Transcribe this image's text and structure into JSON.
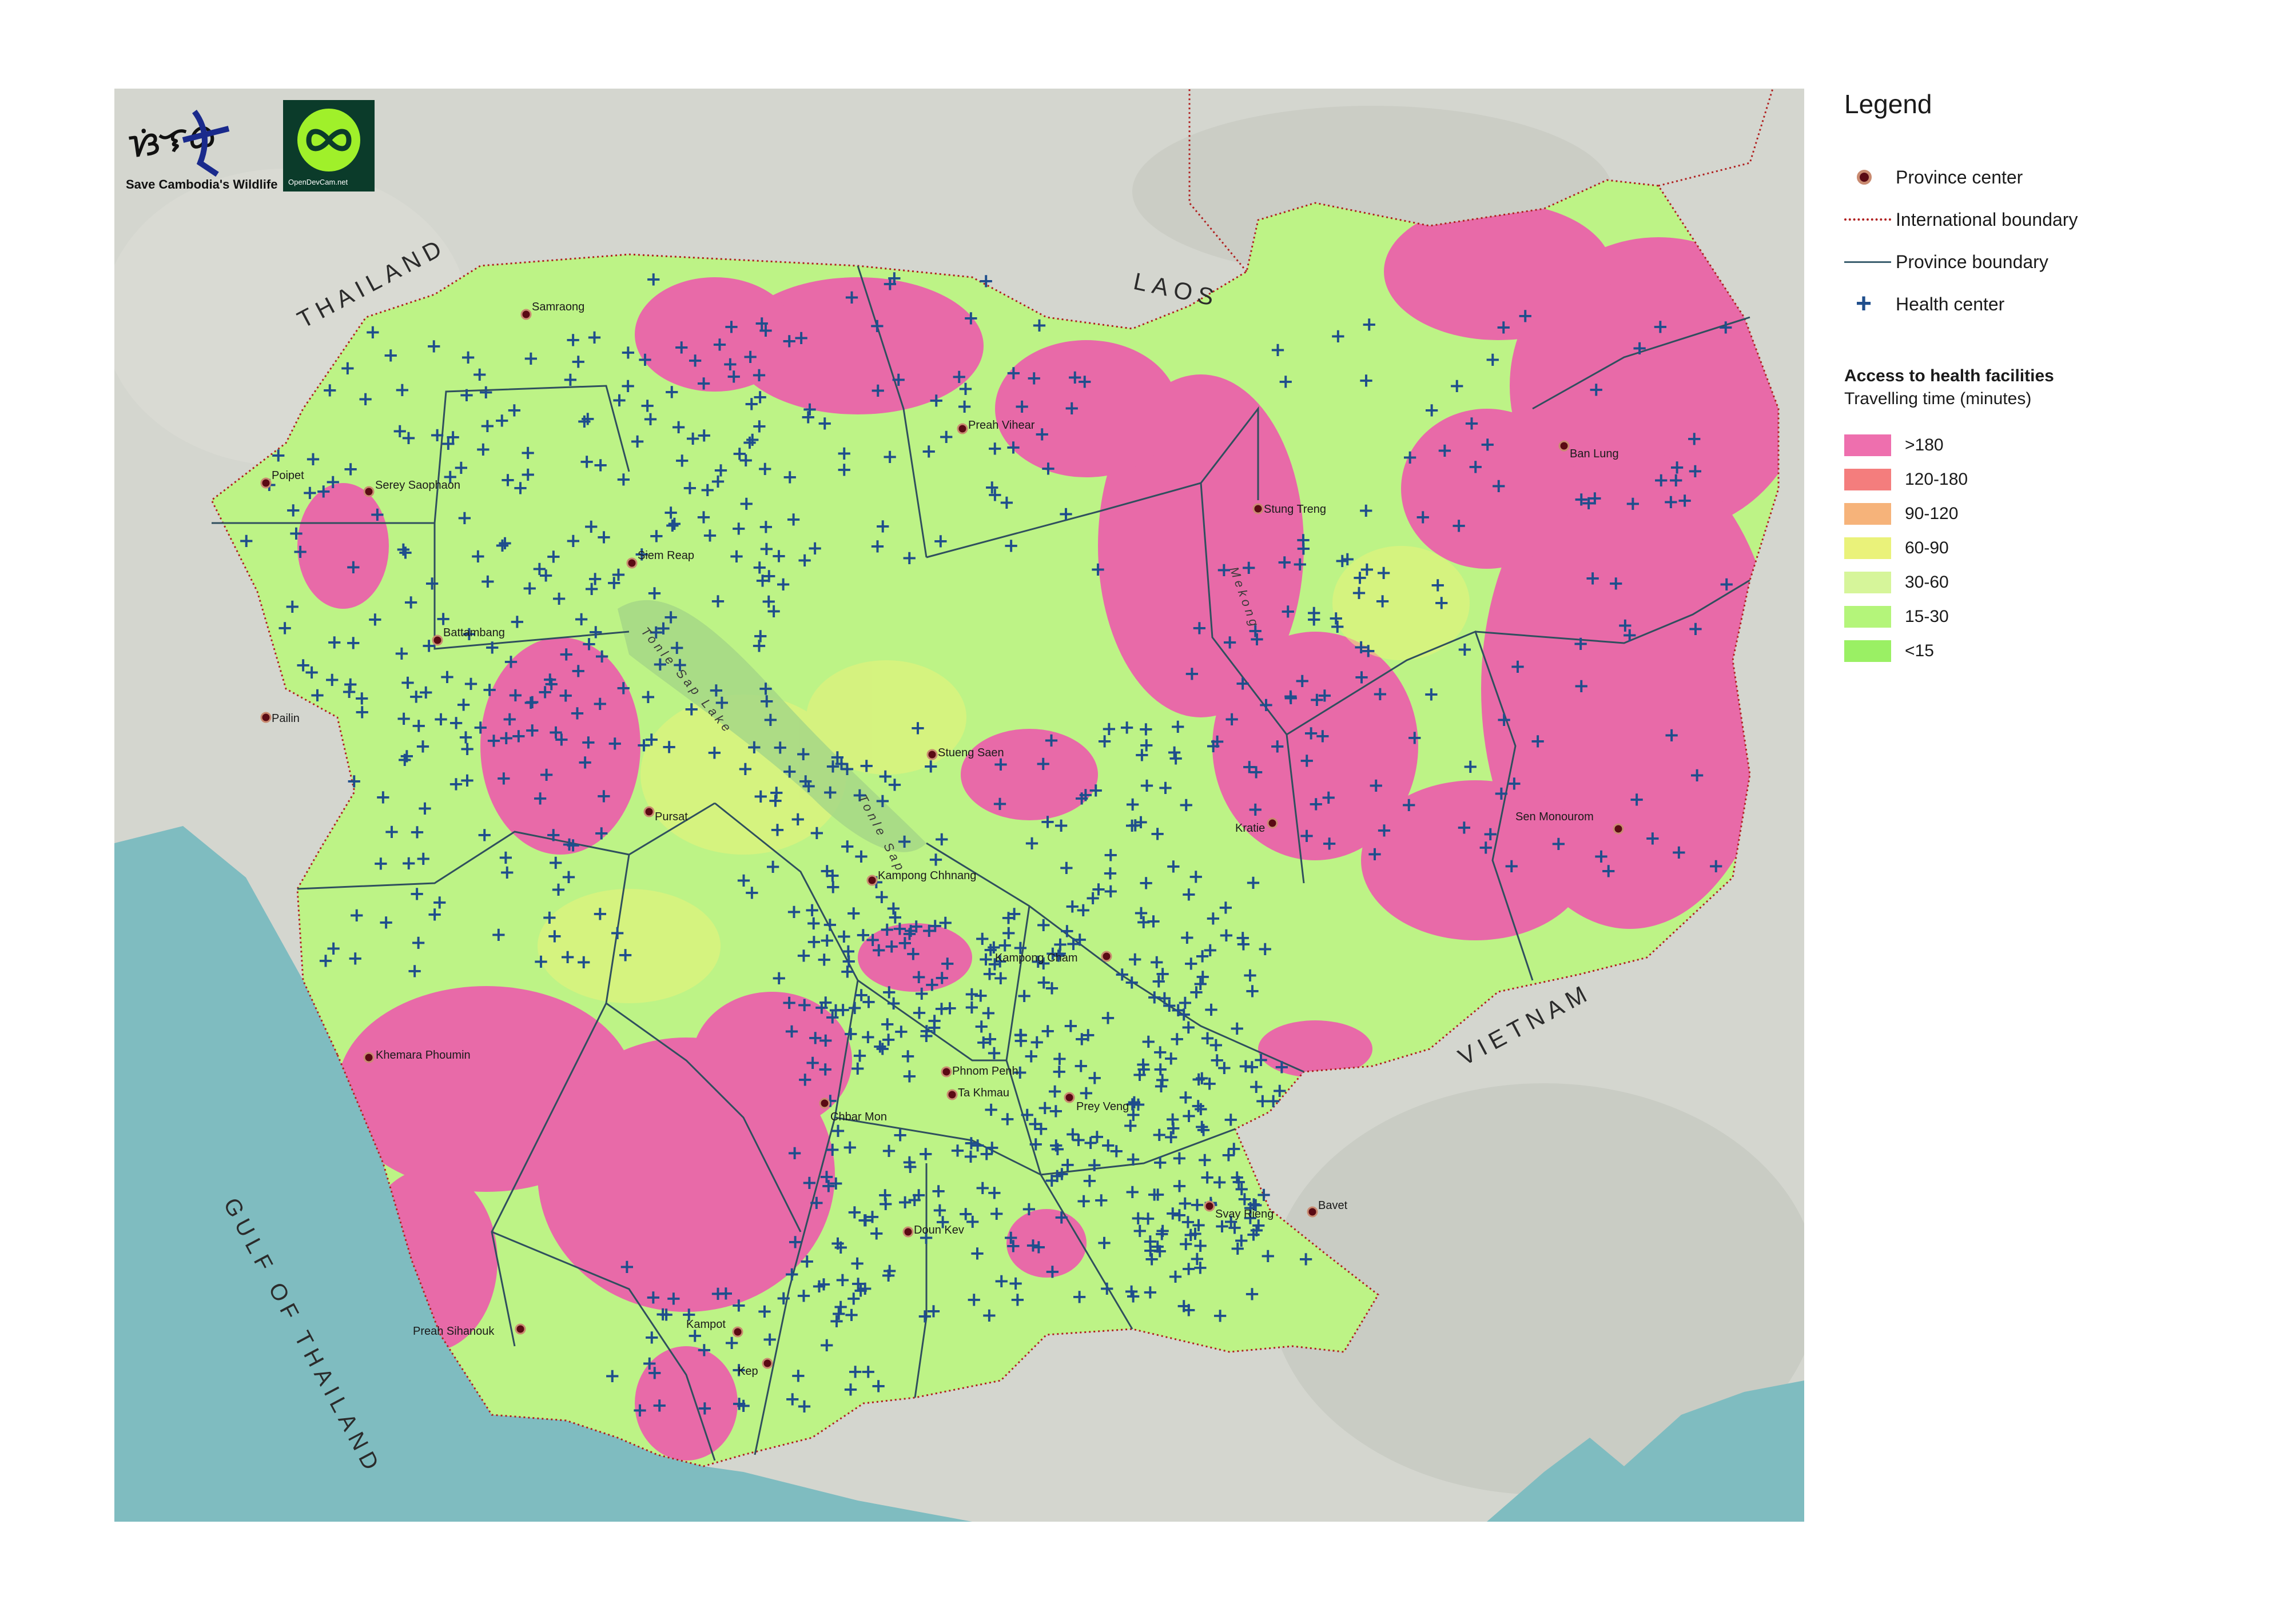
{
  "logos": {
    "wildlife_org": "Save Cambodia's Wildlife",
    "odc_site": "OpenDevCam.net"
  },
  "countries": {
    "thailand": "THAILAND",
    "laos": "LAOS",
    "vietnam": "VIETNAM"
  },
  "water": {
    "gulf": "GULF OF THAILAND",
    "lake": "Tonle Sap Lake",
    "river_tonle": "Tonle Sap",
    "river_mekong": "Mekong"
  },
  "places": {
    "samraong": "Samraong",
    "poipet": "Poipet",
    "serey_saophaon": "Serey Saophaon",
    "siem_reap": "Siem Reap",
    "preah_vihear": "Preah Vihear",
    "stung_treng": "Stung Treng",
    "ban_lung": "Ban Lung",
    "battambang": "Battambang",
    "pailin": "Pailin",
    "stueng_saen": "Stueng Saen",
    "pursat": "Pursat",
    "kratie": "Kratie",
    "sen_monourom": "Sen Monourom",
    "kampong_chhnang": "Kampong Chhnang",
    "kampong_cham": "Kampong Cham",
    "khemara_phoumin": "Khemara Phoumin",
    "phnom_penh": "Phnom Penh",
    "ta_khmau": "Ta Khmau",
    "chbar_mon": "Chbar Mon",
    "prey_veng": "Prey Veng",
    "bavet": "Bavet",
    "svay_rieng": "Svay Rieng",
    "doun_kev": "Doun Kev",
    "preah_sihanouk": "Preah Sihanouk",
    "kampot": "Kampot",
    "kep": "Kep"
  },
  "legend": {
    "title": "Legend",
    "province_center": "Province center",
    "intl_boundary": "International boundary",
    "province_boundary": "Province boundary",
    "health_center": "Health center",
    "access_title": "Access to health facilities",
    "access_subtitle": "Travelling time (minutes)",
    "classes": [
      {
        "label": ">180",
        "color": "#ee6fae"
      },
      {
        "label": "120-180",
        "color": "#f47d7d"
      },
      {
        "label": "90-120",
        "color": "#f6b37a"
      },
      {
        "label": "60-90",
        "color": "#eaf27a"
      },
      {
        "label": "30-60",
        "color": "#d6f59a"
      },
      {
        "label": "15-30",
        "color": "#b4f57a"
      },
      {
        "label": "<15",
        "color": "#9af064"
      }
    ]
  },
  "colors": {
    "sea": "#7fbcc0",
    "land_outside": "#d4d6cf",
    "country_base": "#bdf386",
    "remote": "#e86aa8",
    "intl_boundary": "#b02020",
    "province_boundary": "#2f4f5e",
    "health_center": "#1f4e8c",
    "province_center": "#5a0a14"
  }
}
